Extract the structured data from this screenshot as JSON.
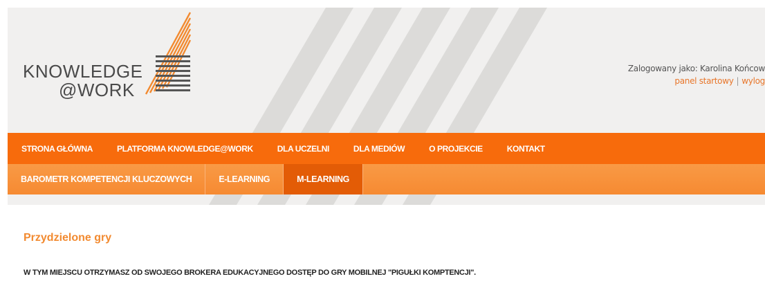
{
  "brand": {
    "line1": "KNOWLEDGE",
    "line2": "@WORK",
    "accent_color": "#f76b0c"
  },
  "user": {
    "logged_in_text": "Zalogowany jako: Karolina Końcow",
    "panel_link": "panel startowy",
    "separator": "|",
    "logout_link": "wylog"
  },
  "main_nav": {
    "items": [
      {
        "label": "STRONA GŁÓWNA"
      },
      {
        "label": "PLATFORMA KNOWLEDGE@WORK"
      },
      {
        "label": "DLA UCZELNI"
      },
      {
        "label": "DLA MEDIÓW"
      },
      {
        "label": "O PROJEKCIE"
      },
      {
        "label": "KONTAKT"
      }
    ]
  },
  "sub_nav": {
    "items": [
      {
        "label": "BAROMETR KOMPETENCJI KLUCZOWYCH"
      },
      {
        "label": "E-LEARNING"
      },
      {
        "label": "M-LEARNING",
        "active": true
      }
    ]
  },
  "content": {
    "title": "Przydzielone gry",
    "notice": "W TYM MIEJSCU OTRZYMASZ OD SWOJEGO BROKERA EDUKACYJNEGO DOSTĘP DO GRY MOBILNEJ \"PIGUŁKI KOMPTENCJI\"."
  }
}
